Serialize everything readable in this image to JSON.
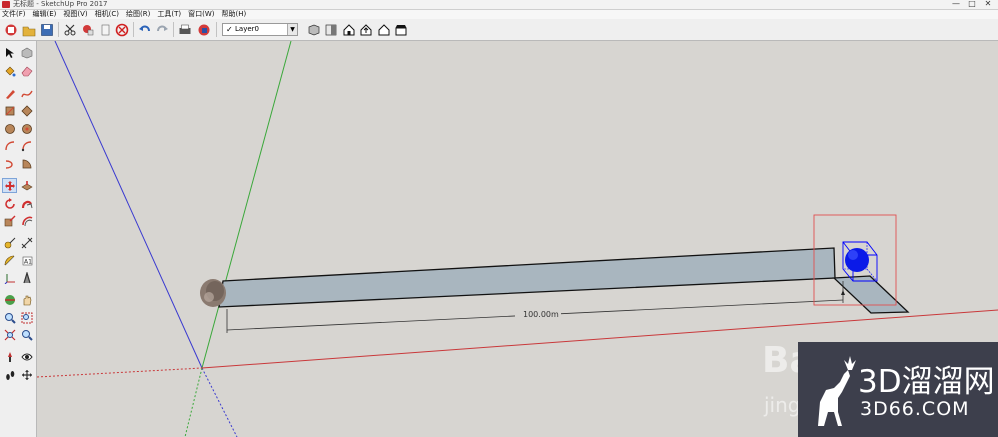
{
  "window": {
    "title": "无标题 - SketchUp Pro 2017",
    "controls": [
      "—",
      "□",
      "✕"
    ]
  },
  "menu": [
    "文件(F)",
    "编辑(E)",
    "视图(V)",
    "相机(C)",
    "绘图(R)",
    "工具(T)",
    "窗口(W)",
    "帮助(H)"
  ],
  "toolbar": {
    "layer": {
      "check": "✓",
      "name": "Layer0"
    }
  },
  "scene": {
    "dimension_label": "100.00m"
  },
  "watermark": {
    "brand": "3D溜溜网",
    "url": "3D66.COM",
    "baidu": "Bai",
    "baidu_sub": "jing"
  },
  "colors": {
    "axis_red": "#c9383a",
    "axis_green": "#3aa83a",
    "axis_blue": "#3a3ad0",
    "face": "#a9b6bf",
    "selection": "#0000ff",
    "bbox": "#e05050"
  }
}
